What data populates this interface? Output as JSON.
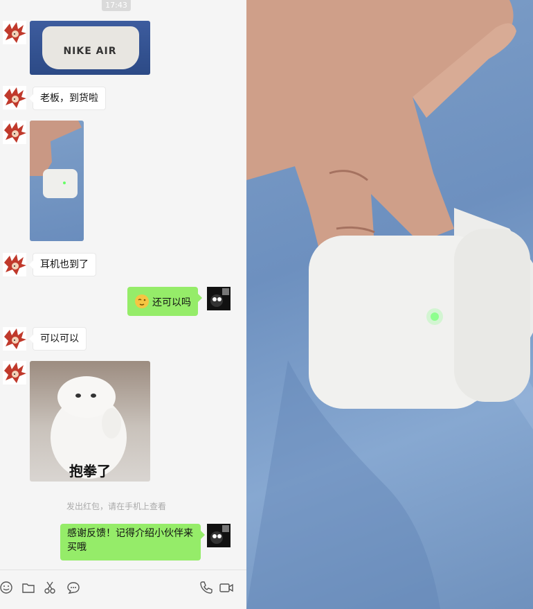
{
  "chat": {
    "timestamp": "17:43",
    "messages": [
      {
        "from": "contact",
        "type": "image",
        "caption": "NIKE AIR"
      },
      {
        "from": "contact",
        "type": "text",
        "text": "老板，到货啦"
      },
      {
        "from": "contact",
        "type": "image"
      },
      {
        "from": "contact",
        "type": "text",
        "text": "耳机也到了"
      },
      {
        "from": "me",
        "type": "text",
        "text": "还可以吗",
        "emoji": "face-emoji"
      },
      {
        "from": "contact",
        "type": "text",
        "text": "可以可以"
      },
      {
        "from": "contact",
        "type": "sticker",
        "caption": "抱拳了"
      },
      {
        "from": "system",
        "type": "notice",
        "text": "发出红包，请在手机上查看"
      },
      {
        "from": "me",
        "type": "text",
        "text": "感谢反馈！记得介绍小伙伴来买哦"
      }
    ]
  },
  "toolbar": {
    "icons": [
      "emoji-icon",
      "folder-icon",
      "scissors-icon",
      "chat-bubble-icon",
      "phone-icon",
      "video-icon"
    ]
  },
  "colors": {
    "outgoing_bubble": "#95ec69",
    "incoming_bubble": "#ffffff",
    "chat_background": "#f5f5f5"
  }
}
